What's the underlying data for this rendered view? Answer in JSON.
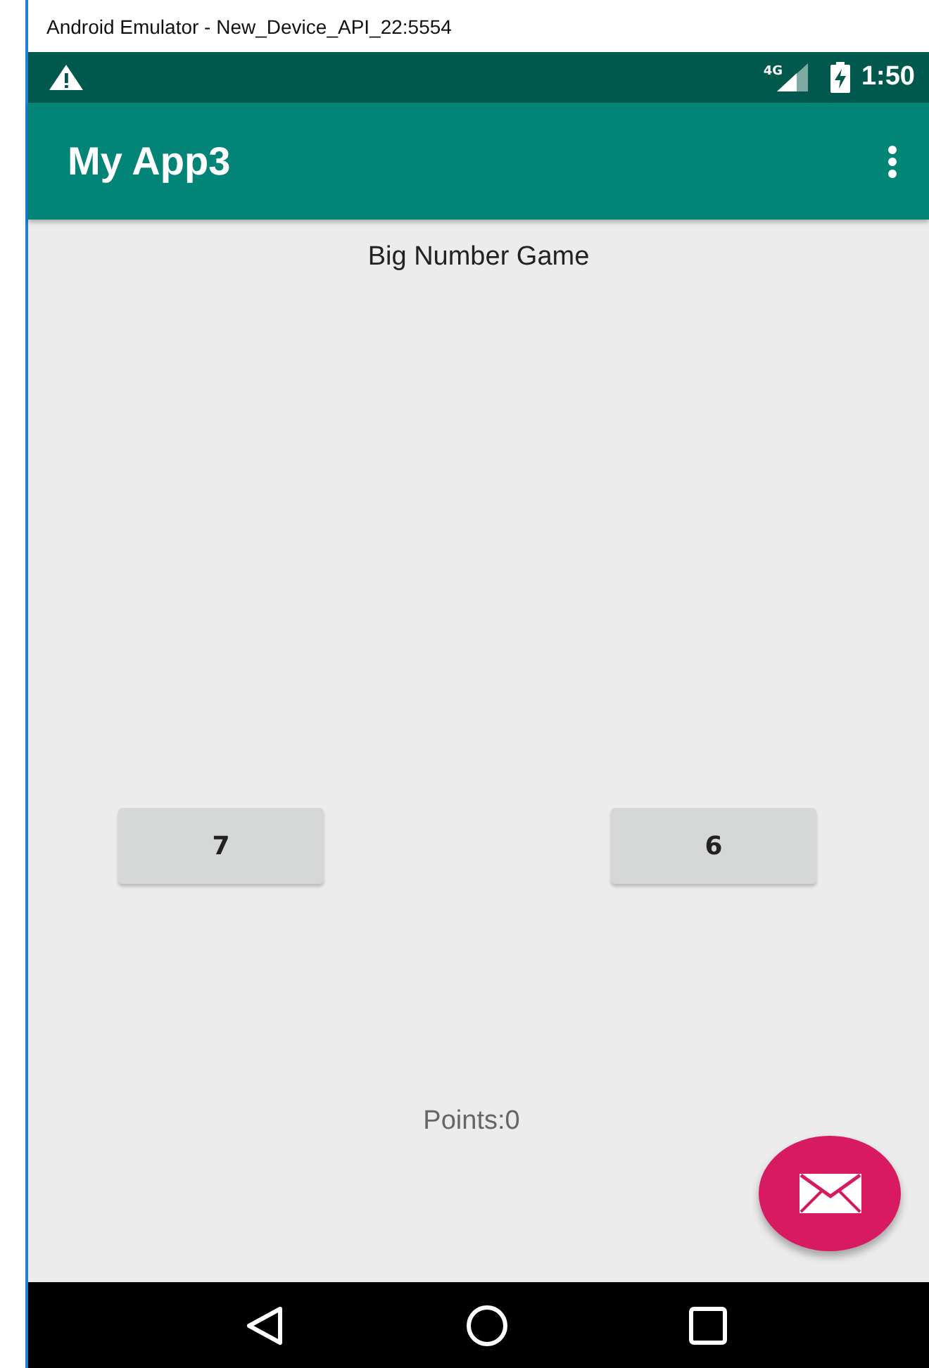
{
  "window": {
    "title": "Android Emulator - New_Device_API_22:5554"
  },
  "status_bar": {
    "network": "4G",
    "time": "1:50"
  },
  "app_bar": {
    "title": "My App3"
  },
  "content": {
    "heading": "Big Number Game",
    "buttons": [
      {
        "label": "7"
      },
      {
        "label": "6"
      }
    ],
    "points": "Points:0"
  }
}
